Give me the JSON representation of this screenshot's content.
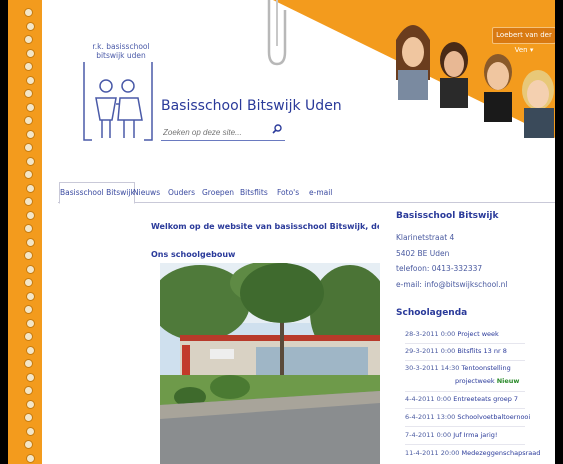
{
  "header": {
    "logo_text_line1": "r.k. basisschool",
    "logo_text_line2": "bitswijk uden",
    "site_title": "Basisschool Bitswijk Uden",
    "search_placeholder": "Zoeken op deze site...",
    "user_button": "Loebert van der Ven"
  },
  "nav": {
    "items": [
      "Basisschool Bitswijk",
      "Nieuws",
      "Ouders",
      "Groepen",
      "Bitsflits",
      "Foto's",
      "e-mail"
    ]
  },
  "main": {
    "welcome": "Welkom op de website van basisschool Bitswijk, de school o",
    "subheading": "Ons schoolgebouw"
  },
  "sidebar": {
    "title": "Basisschool Bitswijk",
    "address": [
      "Klarinetstraat 4",
      "5402 BE Uden",
      "telefoon: 0413-332337",
      "e-mail: info@bitswijkschool.nl"
    ],
    "agenda_title": "Schoolagenda",
    "agenda": [
      {
        "date": "28-3-2011 0:00",
        "event": "Project week"
      },
      {
        "date": "29-3-2011 0:00",
        "event": "Bitsflits 13 nr 8"
      },
      {
        "date": "30-3-2011 14:30",
        "event": "Tentoonstelling"
      },
      {
        "date": "",
        "event": "projectweek"
      },
      {
        "date": "4-4-2011 0:00",
        "event": "Entreeteats groep 7"
      },
      {
        "date": "6-4-2011 13:00",
        "event": "Schoolvoetbaltoernooi"
      },
      {
        "date": "7-4-2011 0:00",
        "event": "Juf Irma jarig!"
      },
      {
        "date": "11-4-2011 20:00",
        "event": "Medezeggenschapsraad"
      }
    ],
    "new_badge": "Nieuw"
  },
  "colors": {
    "accent_orange": "#f39b1d",
    "link_blue": "#2a3a9a"
  }
}
